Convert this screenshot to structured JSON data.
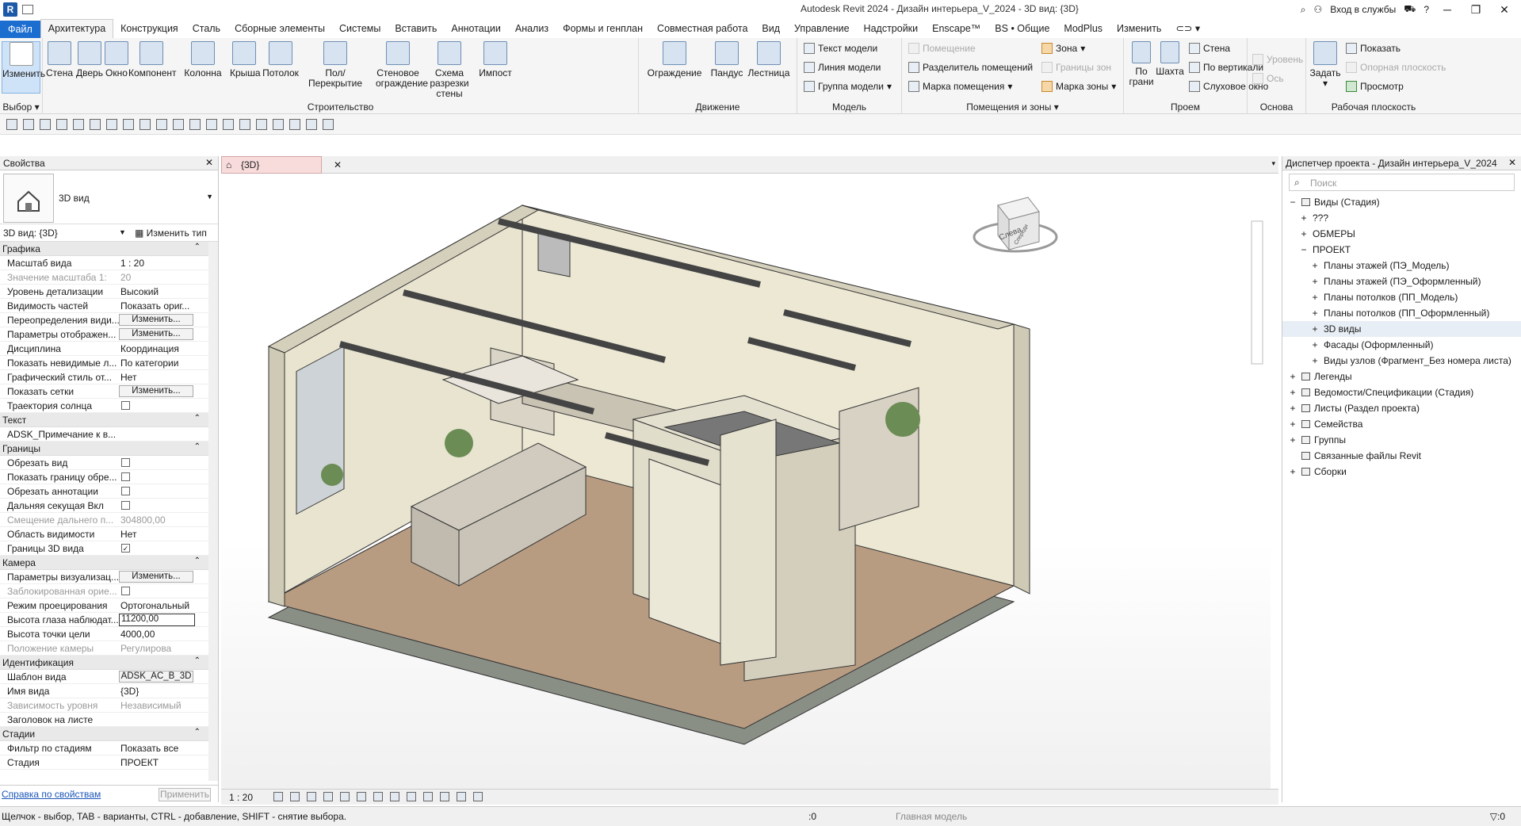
{
  "app": {
    "logo": "R",
    "title": "Autodesk Revit 2024 - Дизайн интерьера_V_2024 - 3D вид: {3D}",
    "signin": "Вход в службы"
  },
  "menu": [
    "Файл",
    "Архитектура",
    "Конструкция",
    "Сталь",
    "Сборные элементы",
    "Системы",
    "Вставить",
    "Аннотации",
    "Анализ",
    "Формы и генплан",
    "Совместная работа",
    "Вид",
    "Управление",
    "Надстройки",
    "Enscape™",
    "BS • Общие",
    "ModPlus",
    "Изменить"
  ],
  "ribbon": {
    "select": {
      "title": "Выбор",
      "modify": "Изменить"
    },
    "build": {
      "title": "Строительство",
      "buttons": [
        "Стена",
        "Дверь",
        "Окно",
        "Компонент",
        "Колонна",
        "Крыша",
        "Потолок",
        "Пол/Перекрытие",
        "Стеновое ограждение",
        "Схема разрезки стены",
        "Импост"
      ]
    },
    "circulation": {
      "title": "Движение",
      "buttons": [
        "Ограждение",
        "Пандус",
        "Лестница"
      ]
    },
    "model": {
      "title": "Модель",
      "items": [
        "Текст модели",
        "Линия модели",
        "Группа модели"
      ]
    },
    "rooms": {
      "title": "Помещения и зоны",
      "items": [
        "Помещение",
        "Разделитель помещений",
        "Марка помещения",
        "Зона",
        "Границы зон",
        "Марка зоны"
      ]
    },
    "opening": {
      "title": "Проем",
      "big": [
        "По грани",
        "Шахта"
      ],
      "items": [
        "Стена",
        "По вертикали",
        "Слуховое окно"
      ]
    },
    "datum": {
      "title": "Основа",
      "items": [
        "Уровень",
        "Ось"
      ]
    },
    "workplane": {
      "title": "Рабочая плоскость",
      "big": "Задать",
      "items": [
        "Показать",
        "Опорная плоскость",
        "Просмотр"
      ]
    }
  },
  "properties": {
    "title": "Свойства",
    "type_name": "3D вид",
    "view_selector": "3D вид: {3D}",
    "edit_type": "Изменить тип",
    "groups": [
      {
        "name": "Графика",
        "rows": [
          {
            "k": "Масштаб вида",
            "v": "1 : 20"
          },
          {
            "k": "Значение масштаба    1:",
            "v": "20",
            "dis": true
          },
          {
            "k": "Уровень детализации",
            "v": "Высокий"
          },
          {
            "k": "Видимость частей",
            "v": "Показать ориг..."
          },
          {
            "k": "Переопределения види...",
            "btn": "Изменить..."
          },
          {
            "k": "Параметры отображен...",
            "btn": "Изменить..."
          },
          {
            "k": "Дисциплина",
            "v": "Координация"
          },
          {
            "k": "Показать невидимые л...",
            "v": "По категории"
          },
          {
            "k": "Графический стиль от...",
            "v": "Нет"
          },
          {
            "k": "Показать сетки",
            "btn": "Изменить..."
          },
          {
            "k": "Траектория солнца",
            "chk": false
          }
        ]
      },
      {
        "name": "Текст",
        "rows": [
          {
            "k": "ADSK_Примечание к в...",
            "v": ""
          }
        ]
      },
      {
        "name": "Границы",
        "rows": [
          {
            "k": "Обрезать вид",
            "chk": false
          },
          {
            "k": "Показать границу обре...",
            "chk": false
          },
          {
            "k": "Обрезать аннотации",
            "chk": false
          },
          {
            "k": "Дальняя секущая Вкл",
            "chk": false
          },
          {
            "k": "Смещение дальнего п...",
            "v": "304800,00",
            "dis": true
          },
          {
            "k": "Область видимости",
            "v": "Нет"
          },
          {
            "k": "Границы 3D вида",
            "chk": true
          }
        ]
      },
      {
        "name": "Камера",
        "rows": [
          {
            "k": "Параметры визуализац...",
            "btn": "Изменить..."
          },
          {
            "k": "Заблокированная орие...",
            "chk": false,
            "dis": true
          },
          {
            "k": "Режим проецирования",
            "v": "Ортогональный"
          },
          {
            "k": "Высота глаза наблюдат...",
            "inp": "11200,00"
          },
          {
            "k": "Высота точки цели",
            "v": "4000,00"
          },
          {
            "k": "Положение камеры",
            "v": "Регулирова",
            "dis": true
          }
        ]
      },
      {
        "name": "Идентификация",
        "rows": [
          {
            "k": "Шаблон вида",
            "btn": "ADSK_AC_B_3D"
          },
          {
            "k": "Имя вида",
            "v": "{3D}"
          },
          {
            "k": "Зависимость уровня",
            "v": "Независимый",
            "dis": true
          },
          {
            "k": "Заголовок на листе",
            "v": ""
          }
        ]
      },
      {
        "name": "Стадии",
        "rows": [
          {
            "k": "Фильтр по стадиям",
            "v": "Показать все"
          },
          {
            "k": "Стадия",
            "v": "ПРОЕКТ"
          }
        ]
      }
    ],
    "help": "Справка по свойствам",
    "apply": "Применить"
  },
  "view": {
    "tab": "{3D}",
    "scale": "1 : 20",
    "viewcube_face": "Слева",
    "viewcube_side": "Спереди"
  },
  "browser": {
    "title": "Диспетчер проекта - Дизайн интерьера_V_2024",
    "search": "Поиск",
    "nodes": [
      {
        "label": "Виды (Стадия)",
        "lvl": 0,
        "tg": "−"
      },
      {
        "label": "???",
        "lvl": 1,
        "tg": "+"
      },
      {
        "label": "ОБМЕРЫ",
        "lvl": 1,
        "tg": "+"
      },
      {
        "label": "ПРОЕКТ",
        "lvl": 1,
        "tg": "−"
      },
      {
        "label": "Планы этажей (ПЭ_Модель)",
        "lvl": 2,
        "tg": "+"
      },
      {
        "label": "Планы этажей (ПЭ_Оформленный)",
        "lvl": 2,
        "tg": "+"
      },
      {
        "label": "Планы потолков (ПП_Модель)",
        "lvl": 2,
        "tg": "+"
      },
      {
        "label": "Планы потолков (ПП_Оформленный)",
        "lvl": 2,
        "tg": "+"
      },
      {
        "label": "3D виды",
        "lvl": 2,
        "tg": "+",
        "sel": true
      },
      {
        "label": "Фасады (Оформленный)",
        "lvl": 2,
        "tg": "+"
      },
      {
        "label": "Виды узлов (Фрагмент_Без номера листа)",
        "lvl": 2,
        "tg": "+"
      },
      {
        "label": "Легенды",
        "lvl": 0,
        "tg": "+"
      },
      {
        "label": "Ведомости/Спецификации (Стадия)",
        "lvl": 0,
        "tg": "+"
      },
      {
        "label": "Листы (Раздел проекта)",
        "lvl": 0,
        "tg": "+"
      },
      {
        "label": "Семейства",
        "lvl": 0,
        "tg": "+"
      },
      {
        "label": "Группы",
        "lvl": 0,
        "tg": "+"
      },
      {
        "label": "Связанные файлы Revit",
        "lvl": 0,
        "tg": ""
      },
      {
        "label": "Сборки",
        "lvl": 0,
        "tg": "+"
      }
    ]
  },
  "status": {
    "message": "Щелчок - выбор, TAB - варианты, CTRL - добавление, SHIFT - снятие выбора.",
    "coord": ":0",
    "model": "Главная модель",
    "filter": ":0"
  }
}
